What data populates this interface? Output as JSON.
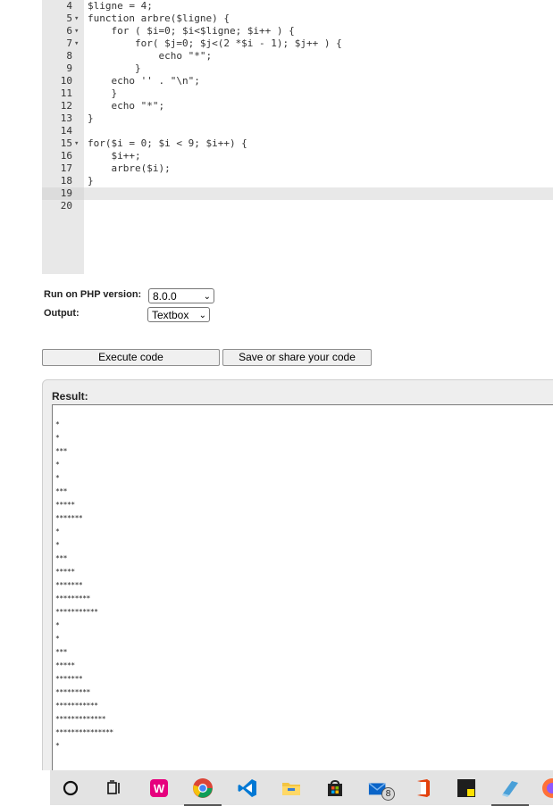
{
  "editor": {
    "lines": [
      {
        "num": "4",
        "fold": "",
        "code": "$ligne = 4;"
      },
      {
        "num": "5",
        "fold": "▾",
        "code": "function arbre($ligne) {"
      },
      {
        "num": "6",
        "fold": "▾",
        "code": "    for ( $i=0; $i<$ligne; $i++ ) {"
      },
      {
        "num": "7",
        "fold": "▾",
        "code": "        for( $j=0; $j<(2 *$i - 1); $j++ ) {"
      },
      {
        "num": "8",
        "fold": "",
        "code": "            echo \"*\";"
      },
      {
        "num": "9",
        "fold": "",
        "code": "        }"
      },
      {
        "num": "10",
        "fold": "",
        "code": "    echo '' . \"\\n\";"
      },
      {
        "num": "11",
        "fold": "",
        "code": "    }"
      },
      {
        "num": "12",
        "fold": "",
        "code": "    echo \"*\";"
      },
      {
        "num": "13",
        "fold": "",
        "code": "}"
      },
      {
        "num": "14",
        "fold": "",
        "code": ""
      },
      {
        "num": "15",
        "fold": "▾",
        "code": "for($i = 0; $i < 9; $i++) {"
      },
      {
        "num": "16",
        "fold": "",
        "code": "    $i++;"
      },
      {
        "num": "17",
        "fold": "",
        "code": "    arbre($i);"
      },
      {
        "num": "18",
        "fold": "",
        "code": "}"
      },
      {
        "num": "19",
        "fold": "",
        "code": ""
      },
      {
        "num": "20",
        "fold": "",
        "code": ""
      }
    ]
  },
  "settings": {
    "php_label": "Run on PHP version:",
    "php_version": "8.0.0",
    "output_label": "Output:",
    "output_mode": "Textbox"
  },
  "buttons": {
    "execute": "Execute code",
    "save": "Save or share your code"
  },
  "result": {
    "title": "Result:",
    "output": [
      "*",
      "*",
      "***",
      "*",
      "*",
      "***",
      "*****",
      "*******",
      "*",
      "*",
      "***",
      "*****",
      "*******",
      "*********",
      "***********",
      "*",
      "*",
      "***",
      "*****",
      "*******",
      "*********",
      "***********",
      "*************",
      "***************",
      "*"
    ]
  },
  "taskbar": {
    "mail_badge": "8",
    "icons": [
      "cortana-icon",
      "task-view-icon",
      "wampserver-icon",
      "chrome-icon",
      "vscode-icon",
      "file-explorer-icon",
      "store-icon",
      "mail-icon",
      "office-icon",
      "sticky-notes-icon",
      "notepad-icon",
      "firefox-icon"
    ]
  }
}
